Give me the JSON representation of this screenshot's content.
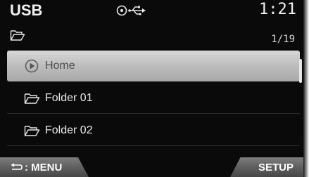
{
  "header": {
    "source": "USB",
    "clock": "1:21",
    "icons": [
      "disc-icon",
      "usb-icon"
    ]
  },
  "path": {
    "icon": "folder-icon",
    "counter": "1/19"
  },
  "list": {
    "items": [
      {
        "icon": "play-circle-icon",
        "label": "Home",
        "selected": true
      },
      {
        "icon": "folder-icon",
        "label": "Folder 01",
        "selected": false
      },
      {
        "icon": "folder-icon",
        "label": "Folder 02",
        "selected": false
      }
    ]
  },
  "softkeys": {
    "menu_label": ": MENU",
    "setup_label": "SETUP",
    "menu_icon": "back-arrow-icon"
  },
  "colors": {
    "background": "#0a0a0a",
    "text": "#f2f2f2",
    "selected_bar": "#c0c0c0",
    "softkey": "#5a5a5a"
  }
}
